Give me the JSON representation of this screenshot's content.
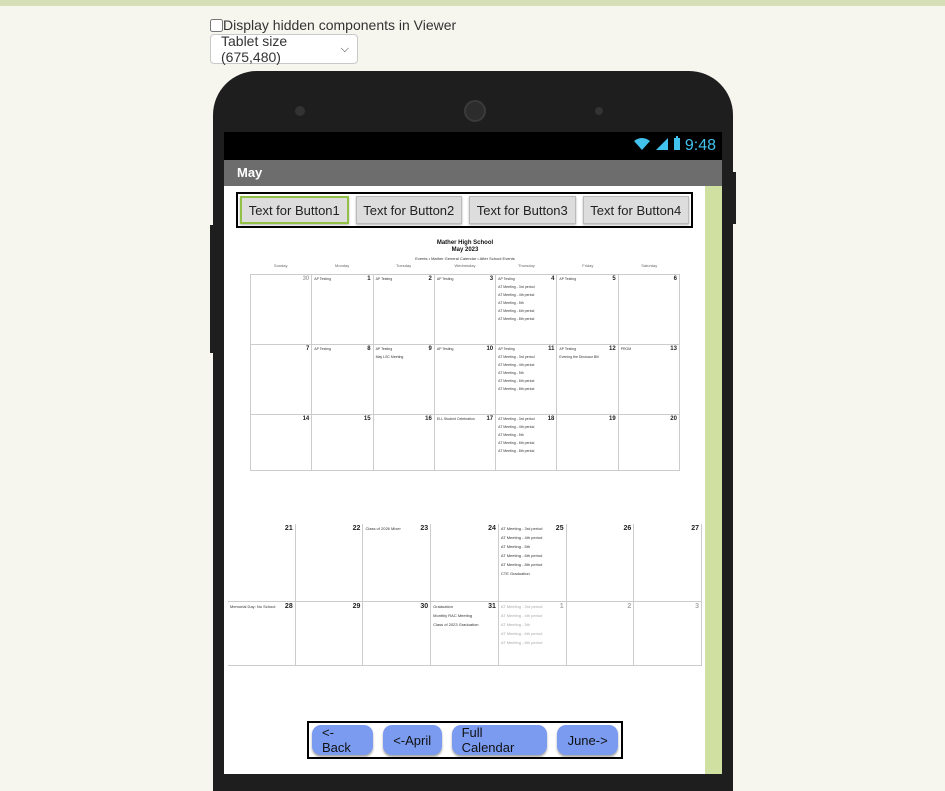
{
  "viewer": {
    "hidden_components_label": "Display hidden components in Viewer",
    "hidden_components_checked": false,
    "size_select_value": "Tablet size (675,480)"
  },
  "status_bar": {
    "time": "9:48"
  },
  "app": {
    "title": "May",
    "top_buttons": [
      "Text for Button1",
      "Text for Button2",
      "Text for Button3",
      "Text for Button4"
    ],
    "bottom_buttons": [
      "<-Back",
      "<-April",
      "Full Calendar",
      "June->"
    ]
  },
  "calendar_image": {
    "school": "Mather High School",
    "month": "May 2023",
    "subtitle": "Events • Mather General Calendar • After School Events",
    "weekdays": [
      "Sunday",
      "Monday",
      "Tuesday",
      "Wednesday",
      "Thursday",
      "Friday",
      "Saturday"
    ],
    "weeks_top": [
      [
        {
          "d": "30",
          "e": [],
          "g": true
        },
        {
          "d": "1",
          "e": [
            "AP Testing"
          ]
        },
        {
          "d": "2",
          "e": [
            "AP Testing"
          ]
        },
        {
          "d": "3",
          "e": [
            "AP Testing"
          ]
        },
        {
          "d": "4",
          "e": [
            "AP Testing",
            "AT Meeting - 3rd period",
            "AT Meeting - 4th period",
            "AT Meeting - 5th",
            "AT Meeting - 6th period",
            "AT Meeting - 8th period"
          ]
        },
        {
          "d": "5",
          "e": [
            "AP Testing"
          ]
        },
        {
          "d": "6",
          "e": []
        }
      ],
      [
        {
          "d": "7",
          "e": []
        },
        {
          "d": "8",
          "e": [
            "AP Testing"
          ]
        },
        {
          "d": "9",
          "e": [
            "AP Testing",
            "May LSC Meeting"
          ]
        },
        {
          "d": "10",
          "e": [
            "AP Testing"
          ]
        },
        {
          "d": "11",
          "e": [
            "AP Testing",
            "AT Meeting - 3rd period",
            "AT Meeting - 4th period",
            "AT Meeting - 5th",
            "AT Meeting - 6th period",
            "AT Meeting - 8th period"
          ]
        },
        {
          "d": "12",
          "e": [
            "AP Testing",
            "Evening the Dinosaur Bill"
          ]
        },
        {
          "d": "13",
          "e": [
            "PROM"
          ]
        }
      ],
      [
        {
          "d": "14",
          "e": []
        },
        {
          "d": "15",
          "e": []
        },
        {
          "d": "16",
          "e": []
        },
        {
          "d": "17",
          "e": [
            "ELL Student Celebration"
          ]
        },
        {
          "d": "18",
          "e": [
            "AT Meeting - 3rd period",
            "AT Meeting - 4th period",
            "AT Meeting - 5th",
            "AT Meeting - 6th period",
            "AT Meeting - 8th period"
          ]
        },
        {
          "d": "19",
          "e": []
        },
        {
          "d": "20",
          "e": []
        }
      ]
    ],
    "weeks_bottom": [
      [
        {
          "d": "21",
          "e": []
        },
        {
          "d": "22",
          "e": []
        },
        {
          "d": "23",
          "e": [
            "Class of 2026 Mixer"
          ]
        },
        {
          "d": "24",
          "e": []
        },
        {
          "d": "25",
          "e": [
            "AT Meeting - 3rd period",
            "AT Meeting - 4th period",
            "AT Meeting - 5th",
            "AT Meeting - 6th period",
            "AT Meeting - 8th period",
            "CTE Graduation"
          ]
        },
        {
          "d": "26",
          "e": []
        },
        {
          "d": "27",
          "e": []
        }
      ],
      [
        {
          "d": "28",
          "e": [
            "Memorial Day: No School"
          ]
        },
        {
          "d": "29",
          "e": []
        },
        {
          "d": "30",
          "e": []
        },
        {
          "d": "31",
          "e": [
            "Graduation",
            "Monthly RAC Meeting",
            "Class of 2023 Graduation"
          ]
        },
        {
          "d": "1",
          "e": [
            "AT Meeting - 3rd period",
            "AT Meeting - 4th period",
            "AT Meeting - 5th",
            "AT Meeting - 6th period",
            "AT Meeting - 8th period"
          ],
          "g": true
        },
        {
          "d": "2",
          "e": [],
          "g": true
        },
        {
          "d": "3",
          "e": [],
          "g": true
        }
      ]
    ]
  }
}
